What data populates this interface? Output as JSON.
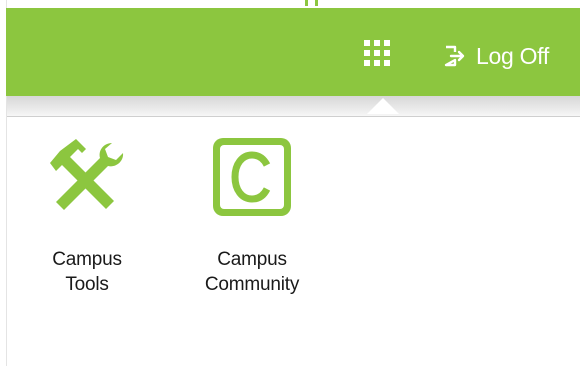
{
  "header": {
    "background_color": "#8cc63f",
    "apps_menu_icon": "grid-icon",
    "logoff": {
      "icon": "logout-icon",
      "label": "Log Off"
    }
  },
  "apps_panel": {
    "items": [
      {
        "icon": "tools-icon",
        "label": "Campus\nTools",
        "accent": "#8cc63f"
      },
      {
        "icon": "community-c-icon",
        "label": "Campus\nCommunity",
        "accent": "#8cc63f"
      }
    ]
  }
}
